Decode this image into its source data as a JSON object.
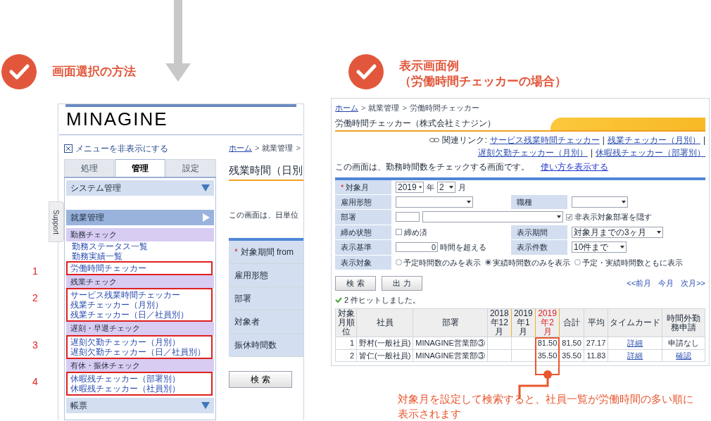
{
  "left": {
    "heading": "画面選択の方法",
    "screen": {
      "logo": "MINAGINE",
      "hide_menu": "メニューを非表示にする",
      "support_tab": "Support",
      "tabs": [
        {
          "label": "処理",
          "selected": false
        },
        {
          "label": "管理",
          "selected": true
        },
        {
          "label": "設定",
          "selected": false
        }
      ],
      "menus": [
        {
          "kind": "dropdown",
          "label": "システム管理"
        },
        {
          "kind": "open",
          "label": "就業管理",
          "groups": [
            {
              "heading": "勤務チェック",
              "links": [
                "勤務ステータス一覧",
                "勤務実績一覧"
              ],
              "marked_links": [
                "労働時間チェッカー"
              ],
              "marker": "1"
            },
            {
              "heading": "残業チェック",
              "marked_links": [
                "サービス残業時間チェッカー",
                "残業チェッカー（月別）",
                "残業チェッカー（日／社員別）"
              ],
              "marker": "2"
            },
            {
              "heading": "遅刻・早退チェック",
              "marked_links": [
                "遅刻欠勤チェッカー（月別）",
                "遅刻欠勤チェッカー（日／社員別）"
              ],
              "marker": "3"
            },
            {
              "heading": "有休・振休チェック",
              "marked_links": [
                "休暇残チェッカー（部署別）",
                "休暇残チェッカー（社員別）"
              ],
              "marker": "4"
            }
          ]
        },
        {
          "kind": "dropdown",
          "label": "帳票"
        }
      ],
      "breadcrumb": [
        {
          "kind": "link",
          "text": "ホーム"
        },
        {
          "kind": "sep",
          "text": ">"
        },
        {
          "kind": "plain",
          "text": "就業管理"
        },
        {
          "kind": "sep",
          "text": ">"
        }
      ],
      "title": "残業時間（日別",
      "description": "この画面は、日単位",
      "fields": [
        {
          "label": "対象期間 from",
          "required_mark": "*"
        },
        {
          "label": "雇用形態"
        },
        {
          "label": "部署"
        },
        {
          "label": "対象者"
        },
        {
          "label": "振休時間数"
        }
      ],
      "search_button": "検 索"
    }
  },
  "right": {
    "heading": [
      "表示画面例",
      "（労働時間チェッカーの場合）"
    ],
    "screen": {
      "breadcrumb": [
        {
          "kind": "link",
          "text": "ホーム"
        },
        {
          "kind": "sep",
          "text": ">"
        },
        {
          "kind": "plain",
          "text": "就業管理"
        },
        {
          "kind": "sep",
          "text": ">"
        },
        {
          "kind": "plain",
          "text": "労働時間チェッカー"
        }
      ],
      "title": "労働時間チェッカー（株式会社ミナジン）",
      "related_label": "関連リンク:",
      "related": [
        {
          "kind": "link",
          "text": "サービス残業時間チェッカー"
        },
        {
          "kind": "sep",
          "text": "|"
        },
        {
          "kind": "link",
          "text": "残業チェッカー（月別）"
        },
        {
          "kind": "sep",
          "text": "|"
        },
        {
          "kind": "link",
          "text": "遅刻欠勤チェッカー（月別）"
        },
        {
          "kind": "sep",
          "text": "|"
        },
        {
          "kind": "link",
          "text": "休暇残チェッカー（部署別）"
        }
      ],
      "description": "この画面は、勤務時間数をチェックする画面です。",
      "help_link": "使い方を表示する",
      "form": {
        "month": {
          "label": "対象月",
          "required_mark": "*",
          "year": "2019",
          "year_unit": "年",
          "month": "2",
          "month_unit": "月"
        },
        "employment": {
          "label": "雇用形態"
        },
        "job": {
          "label": "職種"
        },
        "department": {
          "label": "部署",
          "hide_check": {
            "label": "非表示対象部署を隠す",
            "checked": true
          }
        },
        "closing": {
          "label": "締め状態",
          "check": {
            "label": "締め済",
            "checked": false
          }
        },
        "period": {
          "label": "表示期間",
          "value": "対象月までの3ヶ月"
        },
        "basis": {
          "label": "表示基準",
          "value": "0",
          "unit": "時間を超える"
        },
        "count": {
          "label": "表示件数",
          "value": "10件まで"
        },
        "target": {
          "label": "表示対象",
          "options": [
            {
              "label": "予定時間数のみを表示",
              "selected": false
            },
            {
              "label": "実績時間数のみを表示",
              "selected": true
            },
            {
              "label": "予定・実績時間数ともに表示",
              "selected": false
            }
          ]
        }
      },
      "buttons": [
        "検 索",
        "出 力"
      ],
      "month_nav": [
        "<<前月",
        "今月",
        "次月>>"
      ],
      "result": "2 件ヒットしました。",
      "table": {
        "columns": [
          {
            "kind": "rank",
            "label": "対象月順位"
          },
          {
            "kind": "employee",
            "label": "社員"
          },
          {
            "kind": "department",
            "label": "部署"
          },
          {
            "kind": "past",
            "label": "2018年12月"
          },
          {
            "kind": "past",
            "label": "2019年1月"
          },
          {
            "kind": "current",
            "label": "2019年2月"
          },
          {
            "kind": "total",
            "label": "合計"
          },
          {
            "kind": "average",
            "label": "平均"
          },
          {
            "kind": "timecard",
            "label": "タイムカード"
          },
          {
            "kind": "request",
            "label": "時間外勤務申請"
          }
        ],
        "rows": [
          {
            "rank": "1",
            "employee": "野村(一般社員)",
            "department": "MINAGINE営業部③",
            "current": "81.50",
            "total": "81.50",
            "average": "27.17",
            "timecard": {
              "text": "詳細",
              "link": true
            },
            "request": {
              "text": "申請なし",
              "link": false
            }
          },
          {
            "rank": "2",
            "employee": "皆仁(一般社員)",
            "department": "MINAGINE営業部③",
            "current": "35.50",
            "total": "35.50",
            "average": "11.83",
            "timecard": {
              "text": "詳細",
              "link": true
            },
            "request": {
              "text": "確認",
              "link": true
            }
          }
        ]
      }
    },
    "callout": "対象月を設定して検索すると、社員一覧が労働時間の多い順に表示されます"
  }
}
